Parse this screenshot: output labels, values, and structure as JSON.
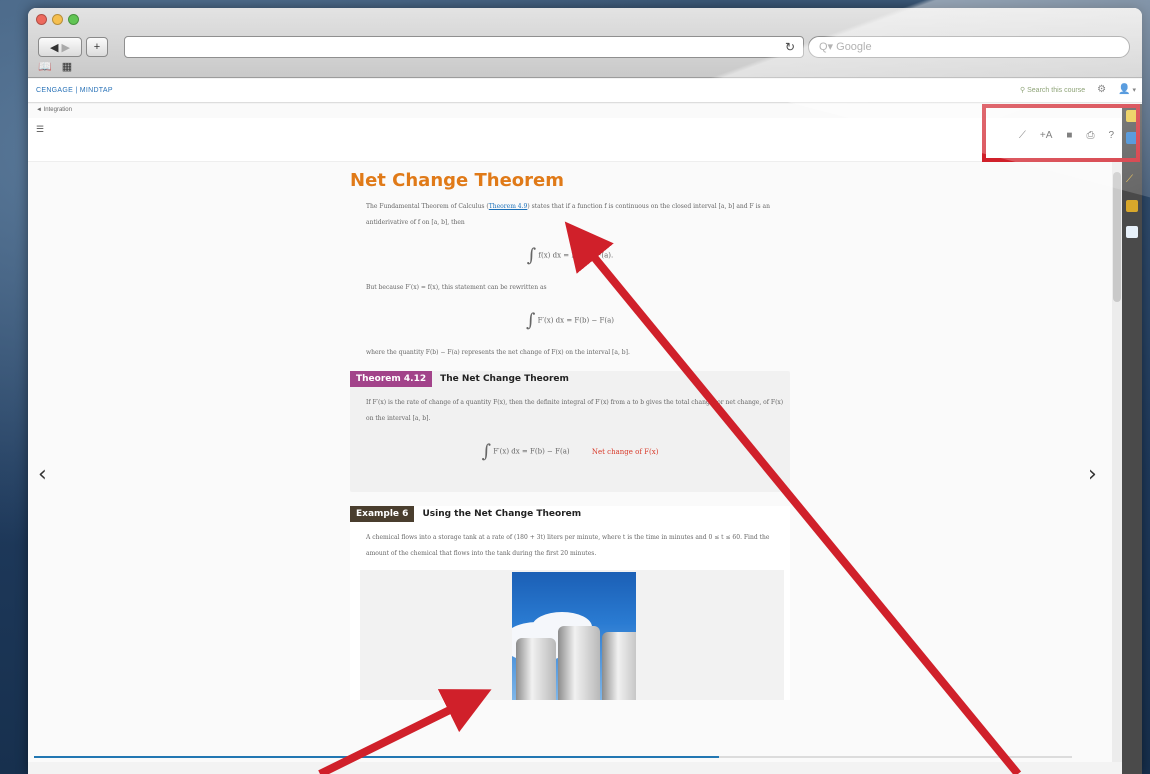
{
  "browser": {
    "search_placeholder": "Q▾ Google",
    "reload_glyph": "↻"
  },
  "app": {
    "brand": "CENGAGE | MINDTAP",
    "search_course": "Search this course",
    "user_menu": "▾",
    "breadcrumb": "◄ Integration"
  },
  "toolbar": {
    "tools": [
      "⟋",
      "+A",
      "■",
      "⎙",
      "?"
    ]
  },
  "reader": {
    "title": "Net Change Theorem",
    "para1_a": "The Fundamental Theorem of Calculus (",
    "para1_link": "Theorem 4.9",
    "para1_b": ") states that if a function f is continuous on the closed interval [a, b] and F is an antiderivative of f on [a, b], then",
    "eq1": "f(x) dx = F(b) − F(a).",
    "para2": "But because F′(x) = f(x), this statement can be rewritten as",
    "eq2": "F′(x) dx = F(b) − F(a)",
    "para3": "where the quantity F(b) − F(a) represents the net change of F(x) on the interval [a, b].",
    "theorem_badge": "Theorem 4.12",
    "theorem_title": "The Net Change Theorem",
    "theorem_text": "If F′(x) is the rate of change of a quantity F(x), then the definite integral of F′(x) from a to b gives the total change, or net change, of F(x) on the interval [a, b].",
    "theorem_eq": "F′(x) dx = F(b) − F(a)",
    "theorem_eq_label": "Net change of F(x)",
    "example_badge": "Example 6",
    "example_title": "Using the Net Change Theorem",
    "example_text": "A chemical flows into a storage tank at a rate of (180 + 3t) liters per minute, where t is the time in minutes and 0 ≤ t ≤ 60. Find the amount of the chemical that flows into the tank during the first 20 minutes."
  },
  "nav": {
    "prev": "‹",
    "next": "›"
  },
  "progress": {
    "fraction": 0.66
  },
  "colors": {
    "accent": "#e07a18",
    "annotation": "#d0202a",
    "link": "#1a6fb8"
  }
}
